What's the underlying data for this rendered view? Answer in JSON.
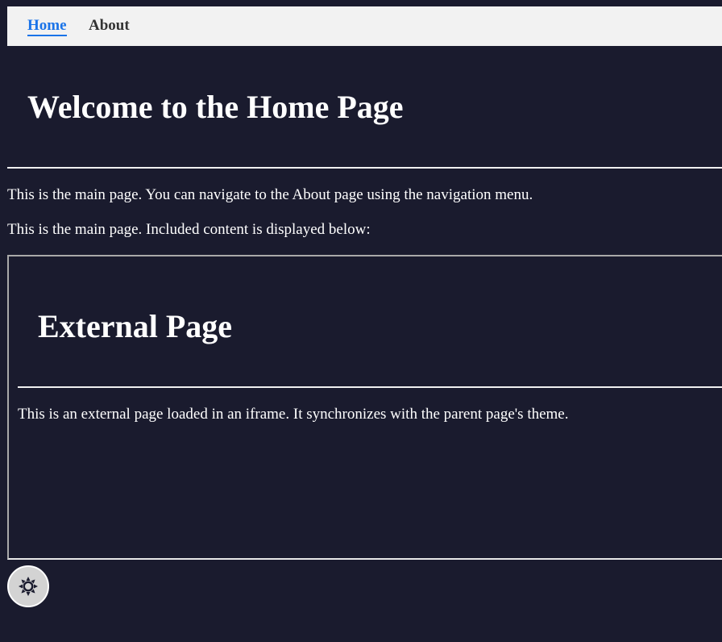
{
  "nav": {
    "items": [
      {
        "label": "Home",
        "active": true
      },
      {
        "label": "About",
        "active": false
      }
    ]
  },
  "main": {
    "title": "Welcome to the Home Page",
    "paragraph1": "This is the main page. You can navigate to the About page using the navigation menu.",
    "paragraph2": "This is the main page. Included content is displayed below:"
  },
  "iframe": {
    "title": "External Page",
    "text": "This is an external page loaded in an iframe. It synchronizes with the parent page's theme."
  },
  "theme_toggle": {
    "icon": "sun-icon"
  },
  "colors": {
    "background": "#1a1b2e",
    "nav_background": "#f2f2f2",
    "active_link": "#1a73e8",
    "text": "#ffffff",
    "toggle_background": "#d3d3d3"
  }
}
